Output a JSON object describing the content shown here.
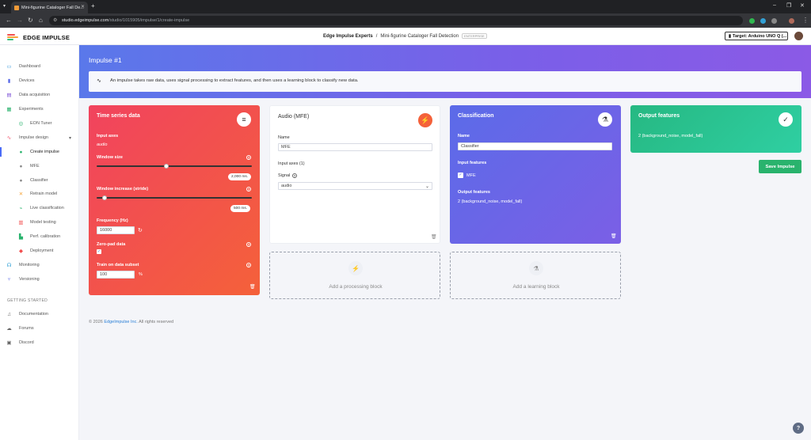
{
  "browser": {
    "tab_title": "Mini-figurine Cataloger Fall De...",
    "url_host": "studio.edgeimpulse.com",
    "url_path": "/studio/1015905/impulse/1/create-impulse"
  },
  "header": {
    "logo_text": "EDGE IMPULSE",
    "crumb_org": "Edge Impulse Experts",
    "crumb_sep": "/",
    "crumb_project": "Mini-figurine Cataloger Fall Detection",
    "crumb_badge": "ENTERPRISE",
    "target_label": "Target: Arduino UNO Q (..."
  },
  "sidebar": {
    "items": [
      {
        "label": "Dashboard",
        "icon": "monitor-icon"
      },
      {
        "label": "Devices",
        "icon": "device-icon"
      },
      {
        "label": "Data acquisition",
        "icon": "database-icon"
      },
      {
        "label": "Experiments",
        "icon": "grid-icon"
      },
      {
        "label": "EON Tuner",
        "icon": "tuner-icon"
      },
      {
        "label": "Impulse design",
        "icon": "pulse-icon"
      },
      {
        "label": "Create impulse",
        "icon": "dot-icon"
      },
      {
        "label": "MFE",
        "icon": "dot-icon"
      },
      {
        "label": "Classifier",
        "icon": "dot-icon"
      },
      {
        "label": "Retrain model",
        "icon": "retrain-icon"
      },
      {
        "label": "Live classification",
        "icon": "live-icon"
      },
      {
        "label": "Model testing",
        "icon": "testing-icon"
      },
      {
        "label": "Perf. calibration",
        "icon": "calibration-icon"
      },
      {
        "label": "Deployment",
        "icon": "deployment-icon"
      },
      {
        "label": "Monitoring",
        "icon": "monitoring-icon"
      },
      {
        "label": "Versioning",
        "icon": "versioning-icon"
      }
    ],
    "section_heading": "GETTING STARTED",
    "getting_started": [
      {
        "label": "Documentation",
        "icon": "docs-icon"
      },
      {
        "label": "Forums",
        "icon": "forums-icon"
      },
      {
        "label": "Discord",
        "icon": "discord-icon"
      }
    ]
  },
  "main": {
    "title": "Impulse #1",
    "info_text": "An impulse takes raw data, uses signal processing to extract features, and then uses a learning block to classify new data."
  },
  "timeseries": {
    "title": "Time series data",
    "input_axes_label": "Input axes",
    "input_axes_value": "audio",
    "window_size_label": "Window size",
    "window_size_value": "2,000 ms.",
    "window_size_fraction": 0.45,
    "window_increase_label": "Window increase (stride)",
    "window_increase_value": "500 ms.",
    "window_increase_fraction": 0.05,
    "frequency_label": "Frequency (Hz)",
    "frequency_value": "16000",
    "zero_pad_label": "Zero-pad data",
    "zero_pad_checked": true,
    "subset_label": "Train on data subset",
    "subset_value": "100",
    "subset_unit": "%"
  },
  "processing": {
    "title": "Audio (MFE)",
    "name_label": "Name",
    "name_value": "MFE",
    "input_axes_label": "Input axes (1)",
    "signal_label": "Signal",
    "signal_value": "audio"
  },
  "learning": {
    "title": "Classification",
    "name_label": "Name",
    "name_value": "Classifier",
    "input_features_label": "Input features",
    "input_feature_item": "MFE",
    "output_features_label": "Output features",
    "output_features_value": "2 (background_noise, model_fall)"
  },
  "output": {
    "title": "Output features",
    "value": "2 (background_noise, model_fall)",
    "save_button": "Save Impulse"
  },
  "add_blocks": {
    "processing": "Add a processing block",
    "learning": "Add a learning block"
  },
  "footer": {
    "copyright": "© 2026",
    "link": "EdgeImpulse Inc.",
    "rights": "All rights reserved"
  },
  "colors": {
    "timeseries_gradient": [
      "#f1435e",
      "#f4613a"
    ],
    "learning_gradient": [
      "#5b6be8",
      "#7b5fe6"
    ],
    "output_gradient": [
      "#26b882",
      "#2fcfa2"
    ],
    "accent": "#4a6cf7",
    "save": "#29b36d"
  }
}
